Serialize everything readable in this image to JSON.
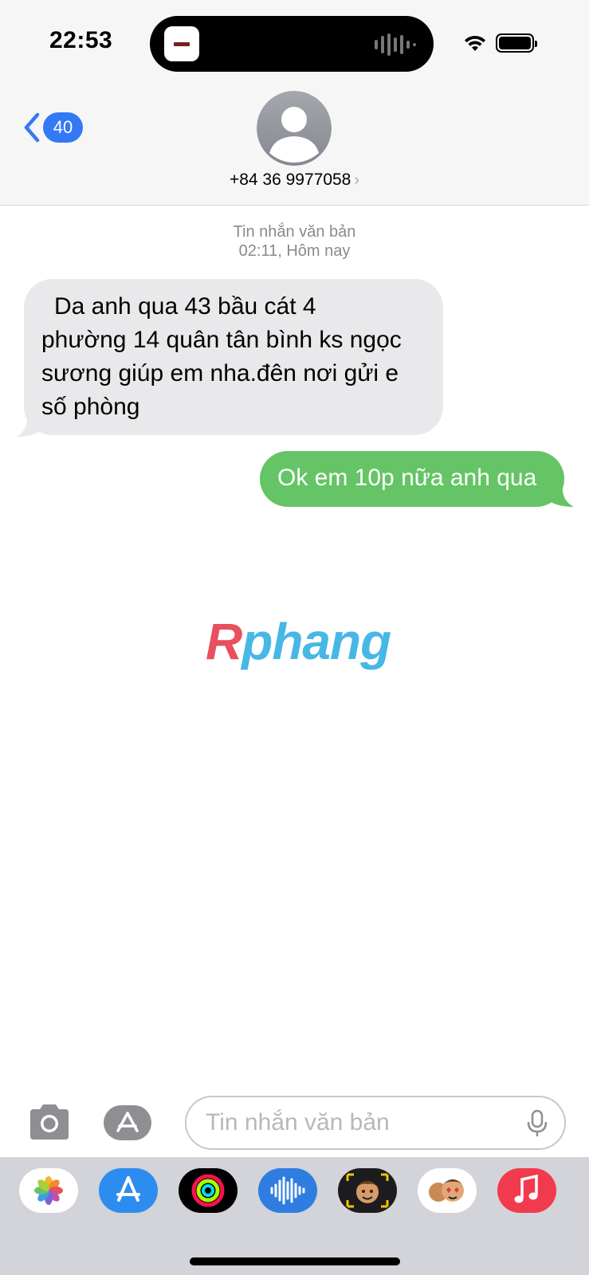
{
  "status_bar": {
    "time": "22:53"
  },
  "header": {
    "back_count": "40",
    "contact_number": "+84 36 9977058",
    "accent_color": "#3478f6"
  },
  "conversation": {
    "meta_type": "Tin nhắn văn bản",
    "meta_time": "02:11, Hôm nay",
    "messages": [
      {
        "direction": "incoming",
        "lines": [
          "Da anh qua 43 bầu cát 4",
          "phường 14 quân tân bình ks ngọc",
          "sương giúp em nha.đên nơi gửi e",
          "số phòng"
        ],
        "color": "#e9e9eb"
      },
      {
        "direction": "outgoing",
        "text": "Ok em 10p nữa anh qua",
        "color": "#65c466"
      }
    ]
  },
  "watermark": {
    "text_first": "R",
    "text_rest": "phang"
  },
  "input_bar": {
    "placeholder": "Tin nhắn văn bản",
    "value": ""
  },
  "app_drawer": {
    "apps": [
      "photos-icon",
      "app-store-icon",
      "fitness-icon",
      "audio-message-icon",
      "memoji-camera-icon",
      "memoji-stickers-icon",
      "music-icon"
    ]
  }
}
